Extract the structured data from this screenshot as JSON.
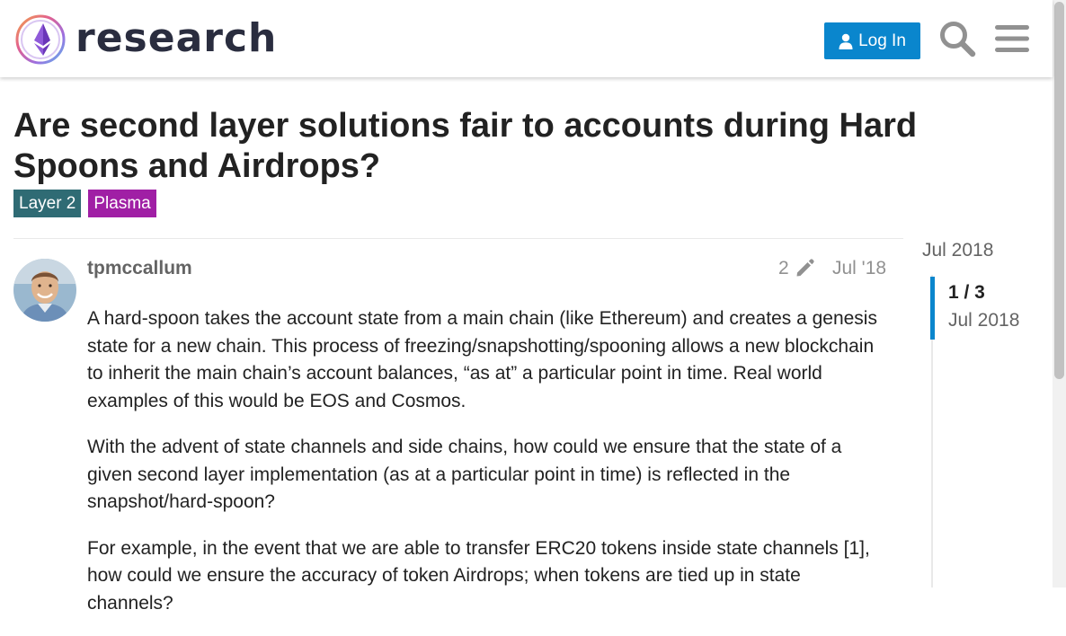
{
  "header": {
    "logo_text": "research",
    "login_label": "Log In",
    "search_icon": "search-icon",
    "menu_icon": "hamburger-menu-icon"
  },
  "topic": {
    "title": "Are second layer solutions fair to accounts during Hard Spoons and Airdrops?",
    "tags": [
      {
        "label": "Layer 2",
        "color": "#2f6b74"
      },
      {
        "label": "Plasma",
        "color": "#a01fa5"
      }
    ]
  },
  "post": {
    "username": "tpmccallum",
    "edit_count": "2",
    "date": "Jul '18",
    "paragraphs": [
      "A hard-spoon takes the account state from a main chain (like Ethereum) and creates a genesis state for a new chain. This process of freezing/snapshotting/spooning allows a new blockchain to inherit the main chain’s account balances, “as at” a particular point in time. Real world examples of this would be EOS and Cosmos.",
      "With the advent of state channels and side chains, how could we ensure that the state of a given second layer implementation (as at a particular point in time) is reflected in the snapshot/hard-spoon?",
      "For example, in the event that we are able to transfer ERC20 tokens inside state channels [1], how could we ensure the accuracy of token Airdrops; when tokens are tied up in state channels?"
    ]
  },
  "timeline": {
    "start_date": "Jul 2018",
    "position": "1 / 3",
    "current_date": "Jul 2018"
  },
  "colors": {
    "accent": "#0a86cd",
    "tag_layer2": "#2f6b74",
    "tag_plasma": "#a01fa5"
  }
}
